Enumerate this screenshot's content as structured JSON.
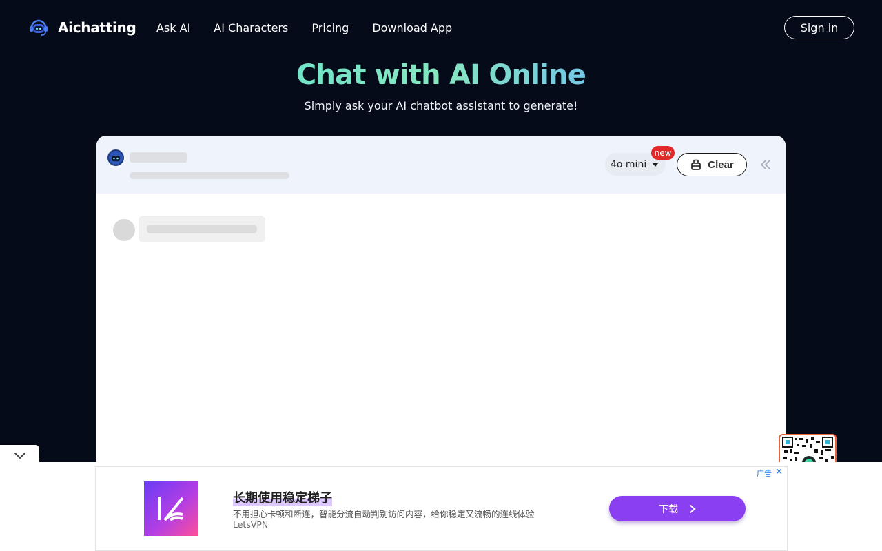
{
  "brand": {
    "name": "Aichatting",
    "icon": "robot-headset-icon"
  },
  "nav": [
    {
      "label": "Ask AI"
    },
    {
      "label": "AI Characters"
    },
    {
      "label": "Pricing"
    },
    {
      "label": "Download App"
    }
  ],
  "header": {
    "signin_label": "Sign in"
  },
  "hero": {
    "title": "Chat with AI Online",
    "subtitle": "Simply ask your AI chatbot assistant to generate!"
  },
  "chat": {
    "model": "4o mini",
    "model_badge": "new",
    "clear_label": "Clear",
    "icons": {
      "clear": "broom-icon",
      "collapse": "double-chevron-left-icon",
      "model_caret": "caret-down-icon"
    }
  },
  "ad": {
    "title": "长期使用稳定梯子",
    "description": "不用担心卡顿和断连，智能分流自动判别访问内容，给你稳定又流畅的连线体验",
    "brand": "LetsVPN",
    "button_label": "下载",
    "ad_label": "广告",
    "close_label": "✕"
  },
  "colors": {
    "background": "#060b19",
    "panel_header": "#eff4fc",
    "ad_button": "#8a3ff0",
    "badge": "#e02a2a"
  }
}
